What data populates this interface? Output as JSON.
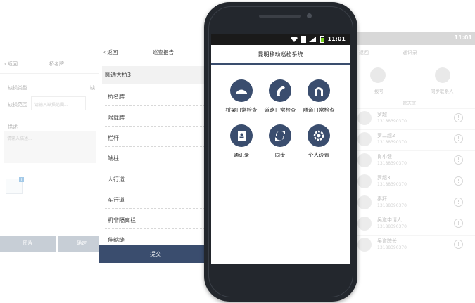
{
  "screen_a": {
    "back_label": "返回",
    "title": "桥名牌",
    "defect_type_label": "缺损类型",
    "defect_type_label_cut": "缺",
    "defect_range_label": "缺损范围",
    "defect_range_placeholder": "请输入缺损范围...",
    "description_label": "描述",
    "description_placeholder": "请输入描述...",
    "photo_button": "图片",
    "confirm_button": "确定"
  },
  "screen_b": {
    "back_label": "返回",
    "title": "巡查报告",
    "bridge_name": "圆通大桥3",
    "items": [
      "桥名牌",
      "限载牌",
      "栏杆",
      "端柱",
      "人行道",
      "车行道",
      "机非隔离栏",
      "伸缩缝"
    ],
    "submit_button": "提交"
  },
  "screen_c": {
    "time": "11:01",
    "nav_back": "返回",
    "nav_title": "通讯录",
    "dial_label": "拨号",
    "sync_label": "同步联系人",
    "section_label": "管志区",
    "contacts": [
      {
        "name": "罗超",
        "phone": "13188390370"
      },
      {
        "name": "罗二超2",
        "phone": "13188390370"
      },
      {
        "name": "肖小健",
        "phone": "13188390370"
      },
      {
        "name": "罗超3",
        "phone": "13188390370"
      },
      {
        "name": "秦拜",
        "phone": "13188390370"
      },
      {
        "name": "吴道申请人",
        "phone": "13188390370"
      },
      {
        "name": "吴道跨长",
        "phone": "13188390370"
      }
    ]
  },
  "phone": {
    "time": "11:01",
    "app_title": "昆明移动巡检系统",
    "tiles": [
      {
        "label": "桥梁日常检查",
        "icon": "bridge-icon"
      },
      {
        "label": "道路日常检查",
        "icon": "road-icon"
      },
      {
        "label": "隧道日常检查",
        "icon": "tunnel-icon"
      },
      {
        "label": "通讯录",
        "icon": "contacts-icon"
      },
      {
        "label": "同步",
        "icon": "sync-icon"
      },
      {
        "label": "个人设置",
        "icon": "settings-icon"
      }
    ]
  },
  "colors": {
    "primary": "#3a4d6e",
    "phone_body": "#23272d",
    "button_gray": "#9aa7b6",
    "battery": "#7ed321"
  }
}
